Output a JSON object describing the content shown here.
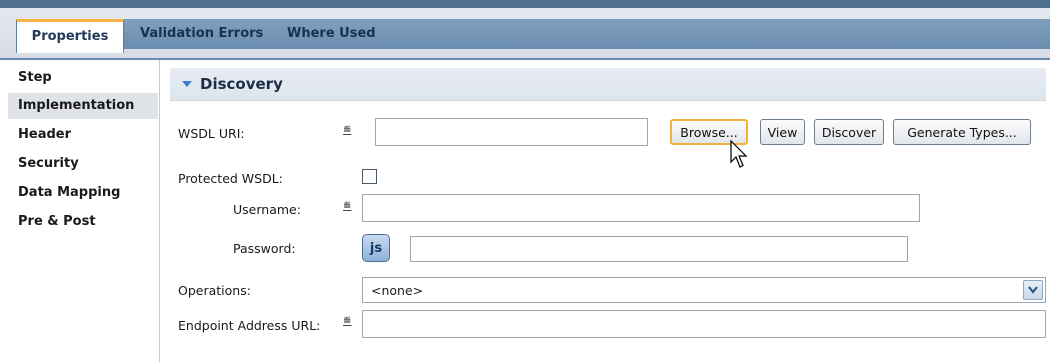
{
  "tabs": {
    "active": "Properties",
    "items": [
      "Validation Errors",
      "Where Used"
    ]
  },
  "sidebar": {
    "items": [
      {
        "label": "Step"
      },
      {
        "label": "Implementation"
      },
      {
        "label": "Header"
      },
      {
        "label": "Security"
      },
      {
        "label": "Data Mapping"
      },
      {
        "label": "Pre & Post"
      }
    ],
    "active_index": 1
  },
  "section": {
    "title": "Discovery",
    "expanded": true
  },
  "form": {
    "wsdl_uri": {
      "label": "WSDL URI:",
      "value": "",
      "icon": "hash-icon"
    },
    "buttons": {
      "browse": "Browse...",
      "view": "View",
      "discover": "Discover",
      "generate_types": "Generate Types..."
    },
    "protected_wsdl": {
      "label": "Protected WSDL:",
      "checked": false
    },
    "username": {
      "label": "Username:",
      "value": "",
      "icon": "hash-icon"
    },
    "password": {
      "label": "Password:",
      "value": "",
      "button": "js"
    },
    "operations": {
      "label": "Operations:",
      "selected": "<none>"
    },
    "endpoint": {
      "label": "Endpoint Address URL:",
      "value": "",
      "icon": "hash-icon"
    },
    "hash_glyph": "≝"
  },
  "colors": {
    "tab_accent": "#f4b247",
    "tab_bar": "#6a8cae",
    "section_header": "#e8edf3",
    "focus_border": "#f0b43a"
  }
}
